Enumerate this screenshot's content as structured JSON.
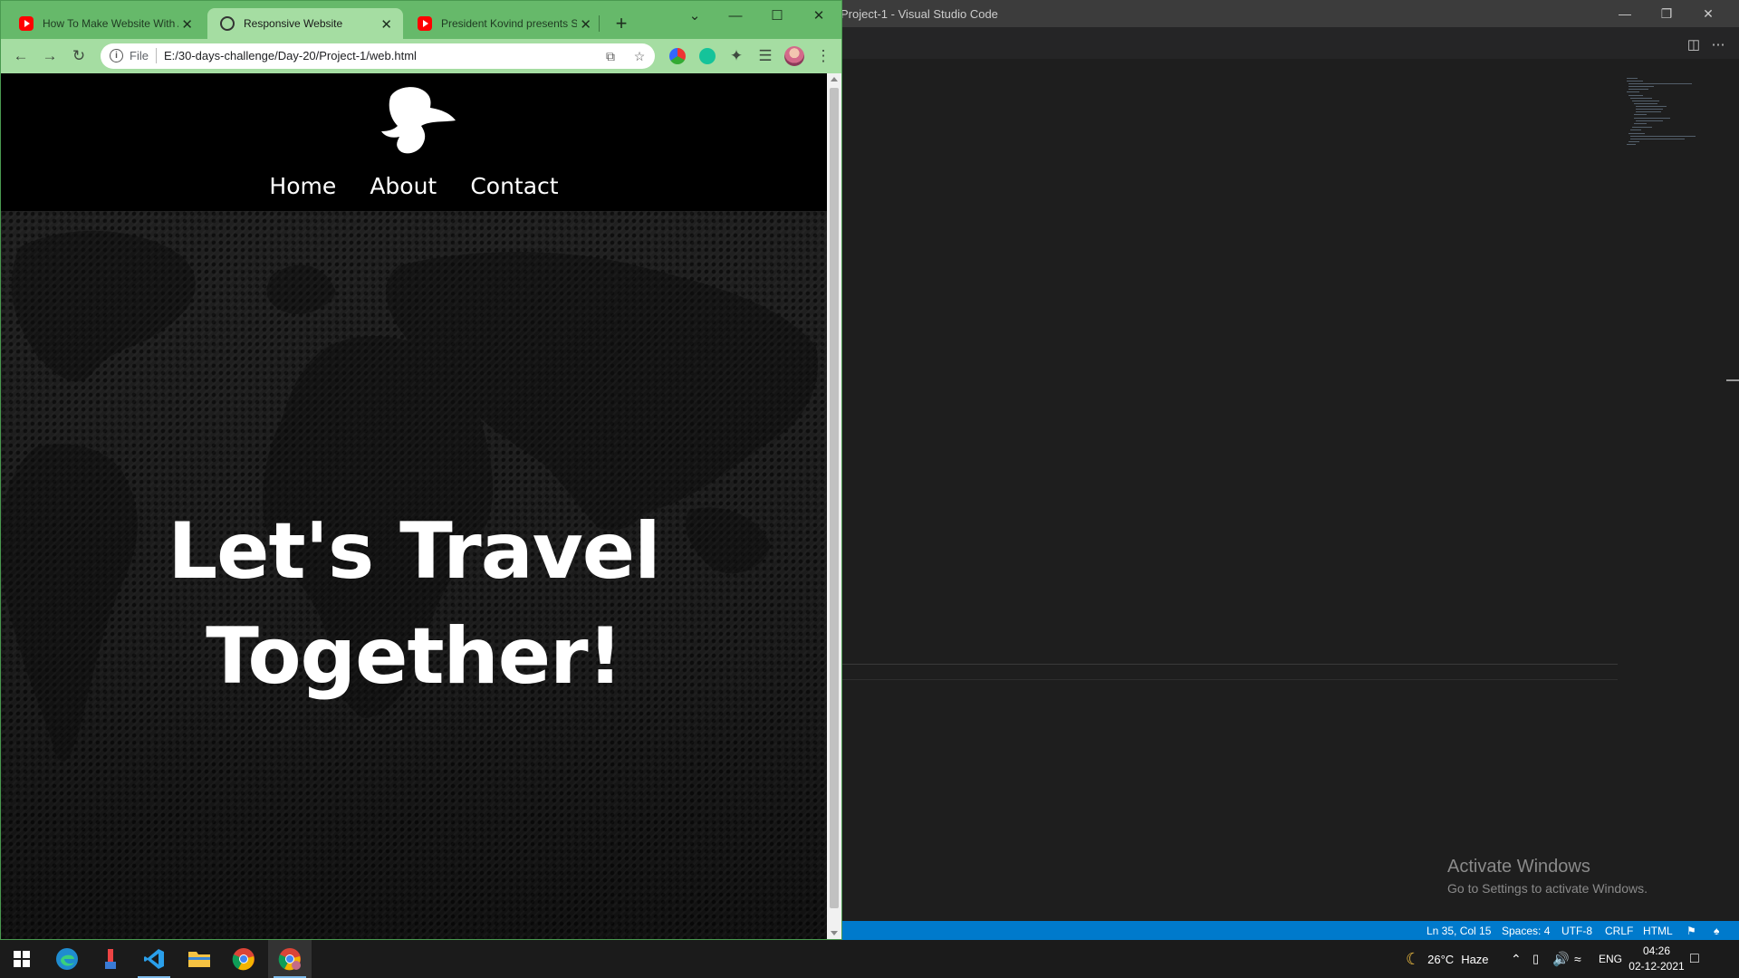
{
  "vscode": {
    "title": "Project-1 - Visual Studio Code",
    "statusbar": {
      "position": "Ln 35, Col 15",
      "spaces": "Spaces: 4",
      "encoding": "UTF-8",
      "eol": "CRLF",
      "language": "HTML"
    }
  },
  "watermark": {
    "line1": "Activate Windows",
    "line2": "Go to Settings to activate Windows."
  },
  "chrome": {
    "tabs": [
      {
        "label": "How To Make Website With Animation",
        "favicon": "youtube-icon",
        "active": false
      },
      {
        "label": "Responsive Website",
        "favicon": "globe-icon",
        "active": true
      },
      {
        "label": "President Kovind presents Shaurya Chakra",
        "favicon": "youtube-icon",
        "active": false
      }
    ],
    "omnibox": {
      "scheme": "File",
      "url": "E:/30-days-challenge/Day-20/Project-1/web.html"
    },
    "accent": "#66b96a",
    "toolbar_color": "#a5dda2"
  },
  "page": {
    "nav": [
      "Home",
      "About",
      "Contact"
    ],
    "hero_line1": "Let's Travel",
    "hero_line2": "Together!"
  },
  "taskbar": {
    "apps": [
      "start-icon",
      "edge-icon",
      "paint-icon",
      "vscode-icon",
      "file-explorer-icon",
      "chrome-icon",
      "chrome-profile-icon"
    ],
    "weather_temp": "26°C",
    "weather_text": "Haze",
    "lang": "ENG",
    "time": "04:26",
    "date": "02-12-2021"
  }
}
